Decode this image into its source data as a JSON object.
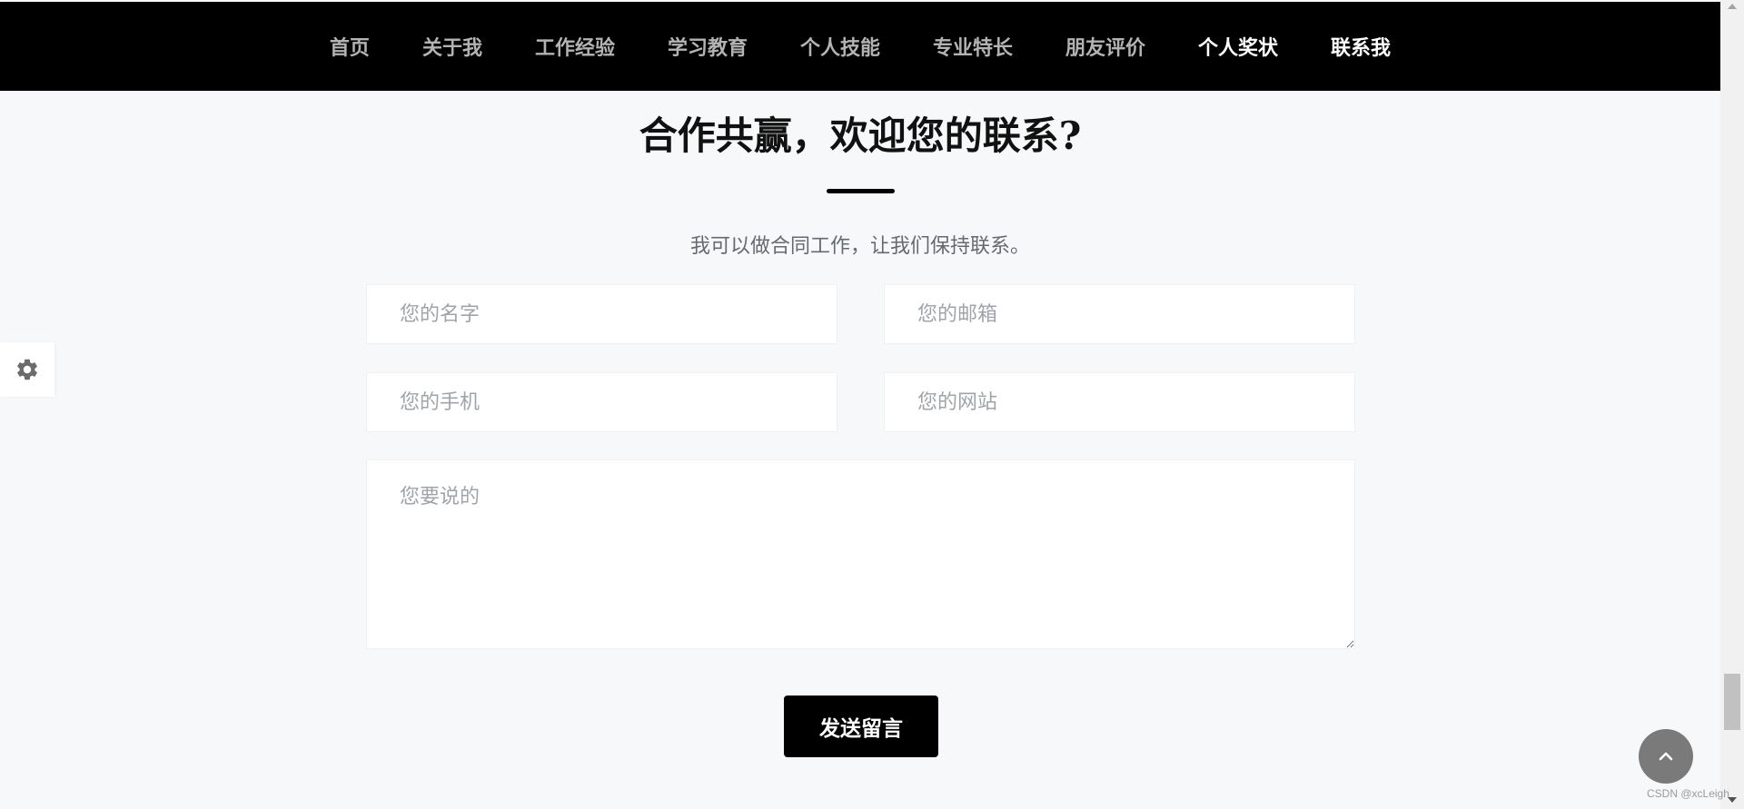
{
  "nav": {
    "items": [
      {
        "label": "首页"
      },
      {
        "label": "关于我"
      },
      {
        "label": "工作经验"
      },
      {
        "label": "学习教育"
      },
      {
        "label": "个人技能"
      },
      {
        "label": "专业特长"
      },
      {
        "label": "朋友评价"
      },
      {
        "label": "个人奖状"
      },
      {
        "label": "联系我"
      }
    ],
    "active_items": [
      "个人奖状",
      "联系我"
    ]
  },
  "contact": {
    "title": "合作共赢，欢迎您的联系?",
    "subtitle": "我可以做合同工作，让我们保持联系。",
    "form": {
      "name_placeholder": "您的名字",
      "email_placeholder": "您的邮箱",
      "phone_placeholder": "您的手机",
      "website_placeholder": "您的网站",
      "message_placeholder": "您要说的",
      "submit_label": "发送留言"
    }
  },
  "widgets": {
    "settings_icon": "gear-icon",
    "scroll_top_icon": "chevron-up-icon"
  },
  "watermark": "CSDN @xcLeigh",
  "colors": {
    "nav_background": "#000000",
    "nav_text": "#b3b3b3",
    "nav_active_text": "#ffffff",
    "page_background": "#f7f8f9",
    "button_background": "#000000",
    "scroll_top_background": "#7a7a7a"
  }
}
